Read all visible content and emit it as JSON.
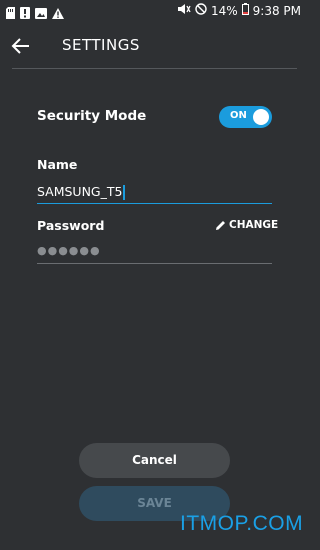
{
  "status_bar": {
    "battery": "14%",
    "time": "9:38 PM",
    "left_icons": [
      "sd-card-icon",
      "alert-icon",
      "image-icon",
      "warning-icon"
    ],
    "right_icons": [
      "mute-icon",
      "do-not-disturb-icon",
      "battery-icon"
    ]
  },
  "header": {
    "title": "SETTINGS",
    "back_icon": "back-arrow-icon"
  },
  "security": {
    "label": "Security Mode",
    "toggle_text": "ON",
    "enabled": true
  },
  "name": {
    "label": "Name",
    "value": "SAMSUNG_T5"
  },
  "password": {
    "label": "Password",
    "change_label": "CHANGE",
    "masked_value": "●●●●●●"
  },
  "buttons": {
    "cancel": "Cancel",
    "save": "SAVE"
  },
  "watermark": "ITMOP.COM",
  "colors": {
    "background": "#2e3033",
    "accent": "#1b9cdd",
    "watermark": "#1aa0e6"
  }
}
